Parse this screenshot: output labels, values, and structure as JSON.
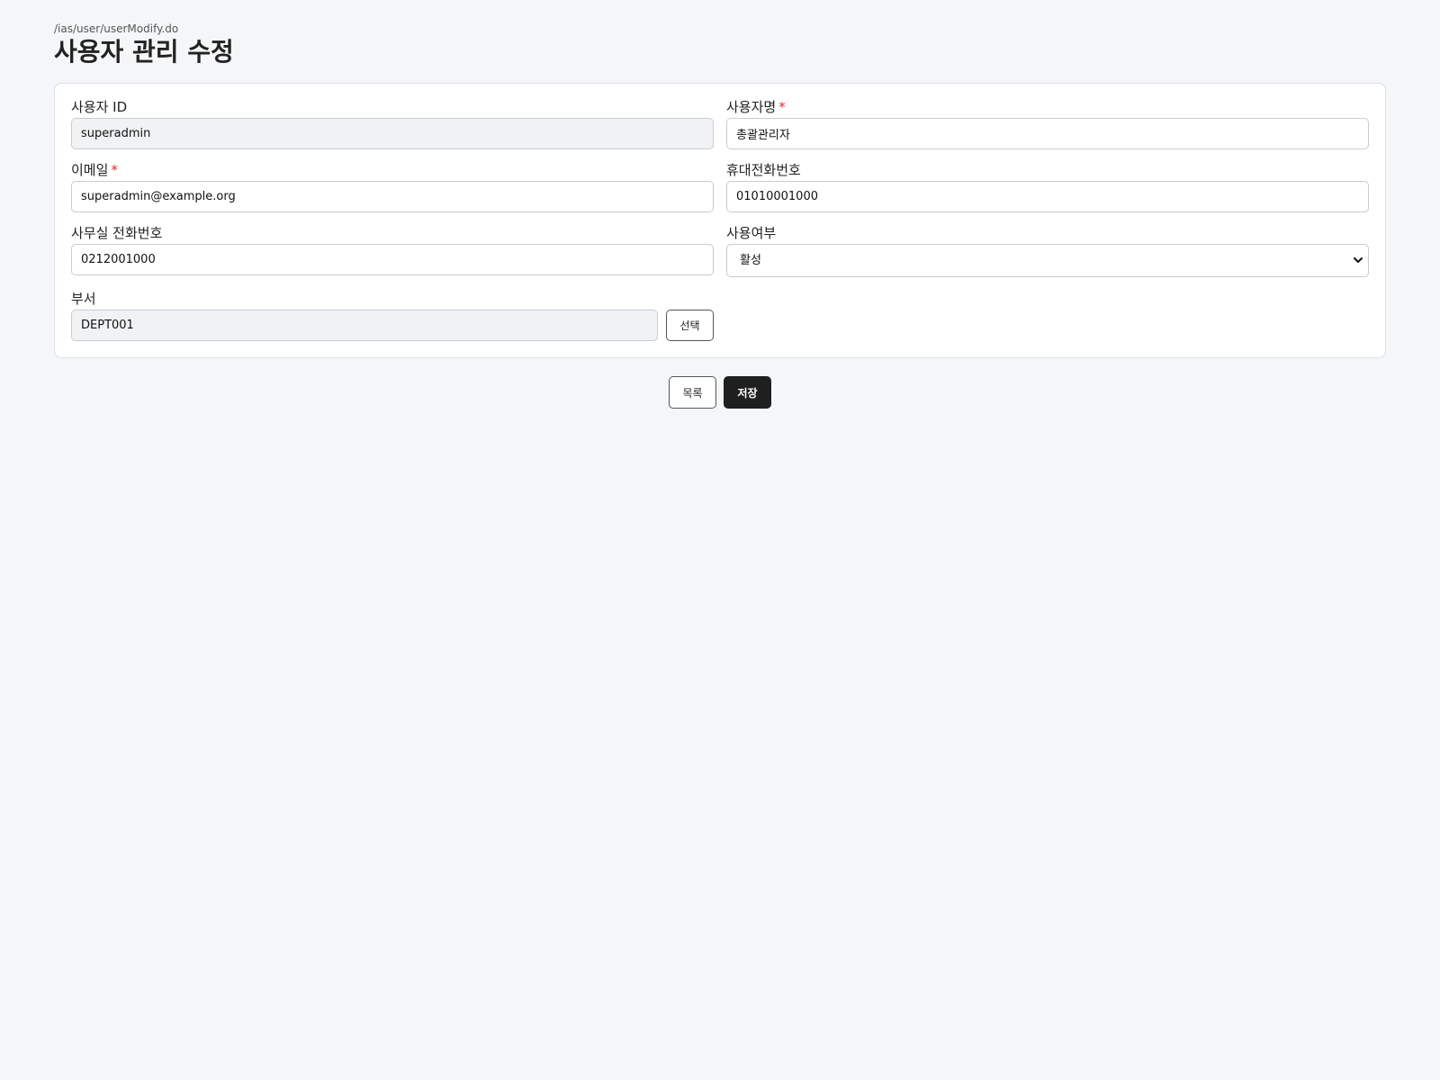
{
  "header": {
    "path": "/ias/user/userModify.do",
    "title": "사용자 관리 수정"
  },
  "form": {
    "user_id": {
      "label": "사용자 ID",
      "value": "superadmin",
      "required": false
    },
    "user_name": {
      "label": "사용자명",
      "value": "총괄관리자",
      "required": true,
      "required_mark": "*"
    },
    "email": {
      "label": "이메일",
      "value": "superadmin@example.org",
      "required": true,
      "required_mark": "*"
    },
    "mobile": {
      "label": "휴대전화번호",
      "value": "01010001000",
      "required": false
    },
    "office_phone": {
      "label": "사무실 전화번호",
      "value": "0212001000",
      "required": false
    },
    "use_status": {
      "label": "사용여부",
      "selected": "활성",
      "icon": "chevron-down-icon"
    },
    "department": {
      "label": "부서",
      "value": "DEPT001",
      "select_label": "선택"
    }
  },
  "actions": {
    "list_label": "목록",
    "save_label": "저장"
  },
  "colors": {
    "background": "#f5f6f8",
    "required": "#d32f2f",
    "primary_button": "#1f1f1f"
  }
}
